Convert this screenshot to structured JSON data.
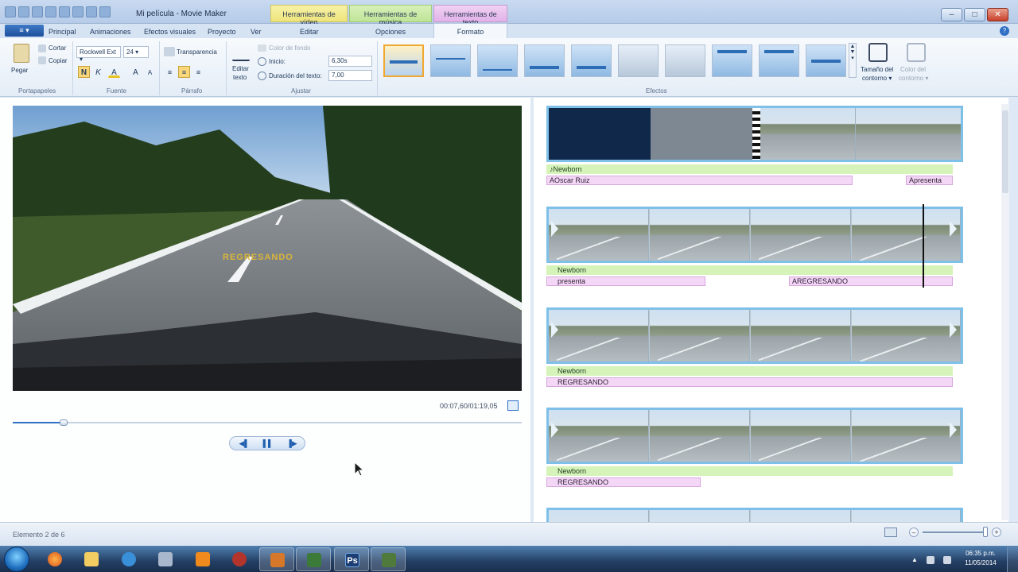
{
  "window": {
    "title": "Mi película - Movie Maker",
    "controls": {
      "minimize": "–",
      "maximize": "□",
      "close": "✕"
    }
  },
  "context_tabs": {
    "video": "Herramientas de vídeo",
    "music": "Herramientas de música",
    "text": "Herramientas de texto"
  },
  "ribbon_tabs": {
    "file": "≡ ▾",
    "items": [
      "Principal",
      "Animaciones",
      "Efectos visuales",
      "Proyecto",
      "Ver",
      "Editar",
      "Opciones",
      "Formato"
    ],
    "active": "Formato",
    "help": "?"
  },
  "clipboard": {
    "paste": "Pegar",
    "cut": "Cortar",
    "copy": "Copiar",
    "group": "Portapapeles"
  },
  "font": {
    "family": "Rockwell Ext",
    "size": "24",
    "bold": "N",
    "italic": "K",
    "color": "A",
    "grow": "A",
    "shrink": "A",
    "group": "Fuente"
  },
  "paragraph": {
    "transparency": "Transparencia",
    "group": "Párrafo"
  },
  "adjust": {
    "edit_text_line1": "Editar",
    "edit_text_line2": "texto",
    "bg_color": "Color de fondo",
    "start_label": "Inicio:",
    "start_value": "6,30s",
    "duration_label": "Duración del texto:",
    "duration_value": "7,00",
    "group": "Ajustar"
  },
  "effects": {
    "group": "Efectos",
    "outline_size_line1": "Tamaño del",
    "outline_size_line2": "contorno ▾",
    "outline_color_line1": "Color del",
    "outline_color_line2": "contorno ▾"
  },
  "preview": {
    "overlay_text": "REGRESANDO",
    "time": "00:07,60/01:19,05",
    "seek_fraction": 0.1,
    "controls": {
      "prev": "◀▌",
      "pause": "▌▌",
      "next": "▐▶"
    }
  },
  "storyboard": {
    "rows": [
      {
        "music": "♪Newborn",
        "texts": [
          "AOscar Ruiz",
          "Apresenta"
        ]
      },
      {
        "music": "Newborn",
        "texts": [
          "presenta",
          "AREGRESANDO"
        ]
      },
      {
        "music": "Newborn",
        "texts": [
          "REGRESANDO"
        ]
      },
      {
        "music": "Newborn",
        "texts": [
          "REGRESANDO"
        ]
      }
    ]
  },
  "status": {
    "item_text": "Elemento 2 de 6",
    "zoom_out": "–",
    "zoom_in": "+"
  },
  "taskbar": {
    "apps": [
      "firefox",
      "explorer",
      "internet-explorer",
      "network",
      "vlc",
      "spider",
      "movie-maker",
      "cards",
      "photoshop",
      "recorder"
    ],
    "photoshop_label": "Ps",
    "clock_time": "06:35 p.m.",
    "clock_date": "11/05/2014"
  }
}
